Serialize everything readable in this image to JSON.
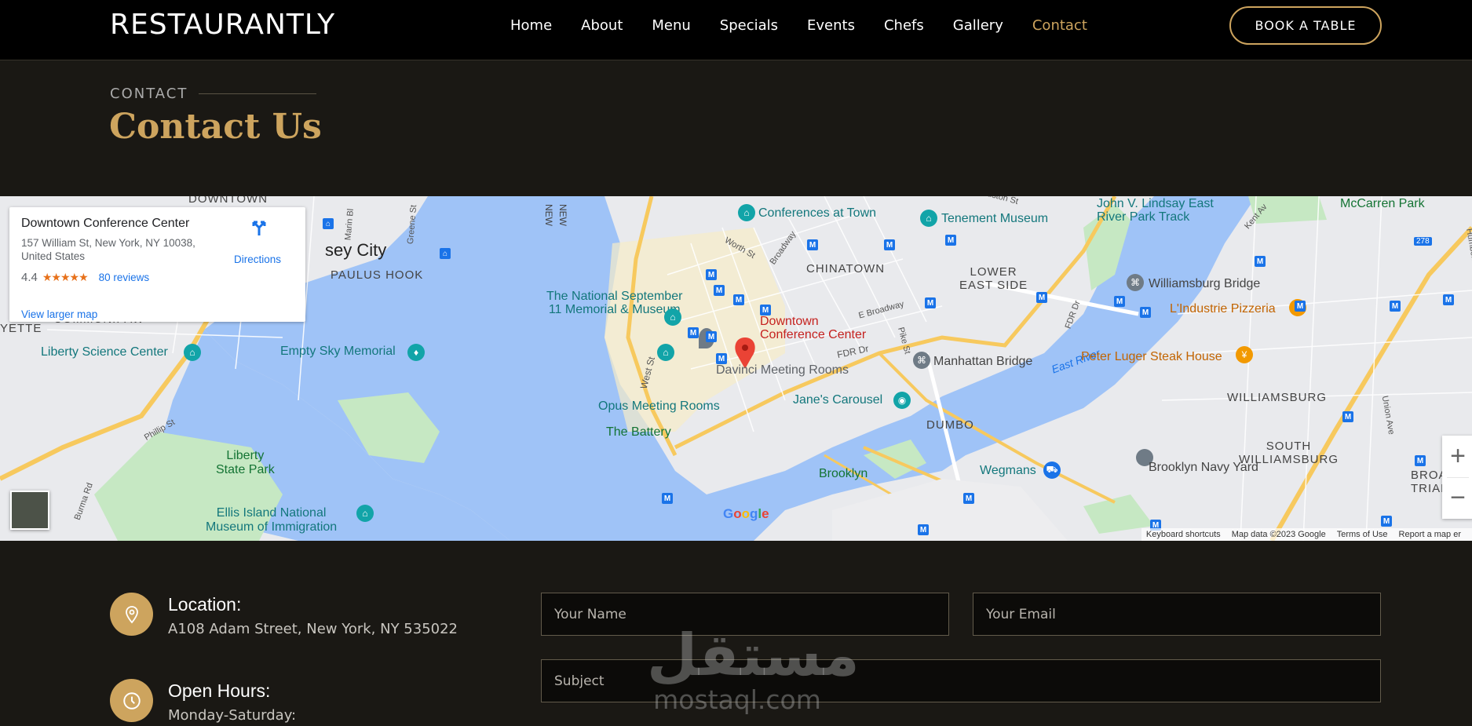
{
  "brand": {
    "name": "RESTAURANTLY",
    "accent": "#cda45e"
  },
  "nav": {
    "items": [
      "Home",
      "About",
      "Menu",
      "Specials",
      "Events",
      "Chefs",
      "Gallery",
      "Contact"
    ],
    "active": "Contact"
  },
  "header": {
    "book_button": "BOOK A TABLE"
  },
  "section": {
    "subtitle": "CONTACT",
    "title": "Contact Us"
  },
  "map": {
    "card": {
      "place_name": "Downtown Conference Center",
      "address": "157 William St, New York, NY 10038, United States",
      "rating": "4.4",
      "stars": "★★★★★",
      "reviews": "80 reviews",
      "larger_map": "View larger map",
      "directions": "Directions"
    },
    "labels": {
      "jersey_city": "sey City",
      "paulus_hook": "PAULUS HOOK",
      "communipaw": "COMMUNIPAW",
      "yette": "YETTE",
      "downtown_top": "DOWNTOWN",
      "liberty_science": "Liberty Science Center",
      "empty_sky": "Empty Sky Memorial",
      "liberty_park_1": "Liberty",
      "liberty_park_2": "State Park",
      "ellis_1": "Ellis Island National",
      "ellis_2": "Museum of Immigration",
      "memorial_1": "The National September",
      "memorial_2": "11 Memorial & Museum",
      "conferences": "Conferences at Town",
      "chinatown": "CHINATOWN",
      "tenement": "Tenement Museum",
      "lower_east_1": "LOWER",
      "lower_east_2": "EAST SIDE",
      "pin_1": "Downtown",
      "pin_2": "Conference Center",
      "davinci": "Davinci Meeting Rooms",
      "opus": "Opus Meeting Rooms",
      "battery": "The Battery",
      "janes": "Jane's Carousel",
      "dumbo": "DUMBO",
      "manhattan_bridge": "Manhattan Bridge",
      "east_river": "East River",
      "fdr": "FDR Dr",
      "brooklyn": "Brooklyn",
      "wegmans": "Wegmans",
      "navy_yard": "Brooklyn Navy Yard",
      "lindsay_1": "John V. Lindsay East",
      "lindsay_2": "River Park Track",
      "mccarren": "McCarren Park",
      "williamsburg_bridge": "Williamsburg Bridge",
      "lindustrie": "L'Industrie Pizzeria",
      "peter_luger": "Peter Luger Steak House",
      "williamsburg": "WILLIAMSBURG",
      "south_w_1": "SOUTH",
      "south_w_2": "WILLIAMSBURG",
      "broadway_tri_1": "BROADW",
      "broadway_tri_2": "TRIANG",
      "phillip": "Phillip St",
      "burma": "Burma Rd",
      "west_st": "West St",
      "worth": "Worth St",
      "broadway_st": "Broadway",
      "e_broadway": "E Broadway",
      "pike": "Pike St",
      "fdr_dr2": "FDR Dr",
      "kent": "Kent Av",
      "union": "Union Ave",
      "humboldt": "Humboldt St",
      "greene": "Greene St",
      "marin": "Marin Bl",
      "ny_1": "NEW",
      "ny_2": "NEW",
      "houston": "uston St",
      "hwy": "278"
    },
    "google": "Google",
    "attribution": [
      "Keyboard shortcuts",
      "Map data ©2023 Google",
      "Terms of Use",
      "Report a map er"
    ]
  },
  "contact": {
    "location_title": "Location:",
    "location_text": "A108 Adam Street, New York, NY 535022",
    "hours_title": "Open Hours:",
    "hours_text": "Monday-Saturday:"
  },
  "form": {
    "name_placeholder": "Your Name",
    "email_placeholder": "Your Email",
    "subject_placeholder": "Subject"
  },
  "watermark": {
    "arabic": "مستقل",
    "latin": "mostaql.com"
  }
}
